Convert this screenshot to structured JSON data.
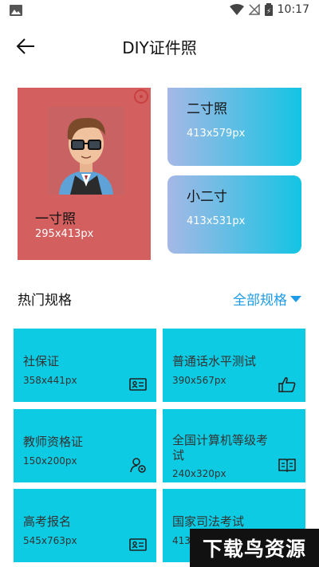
{
  "status": {
    "time": "10:17"
  },
  "header": {
    "title": "DIY证件照",
    "back_icon": "arrow-left-icon"
  },
  "featured": {
    "main": {
      "title": "一寸照",
      "size": "295x413px"
    },
    "side": [
      {
        "title": "二寸照",
        "size": "413x579px"
      },
      {
        "title": "小二寸",
        "size": "413x531px"
      }
    ]
  },
  "hot": {
    "title": "热门规格",
    "all_label": "全部规格"
  },
  "specs": [
    {
      "title": "社保证",
      "size": "358x441px",
      "icon": "id-card-icon"
    },
    {
      "title": "普通话水平测试",
      "size": "390x567px",
      "icon": "thumbs-up-icon"
    },
    {
      "title": "教师资格证",
      "size": "150x200px",
      "icon": "user-badge-icon"
    },
    {
      "title": "全国计算机等级考试",
      "size": "240x320px",
      "icon": "book-icon"
    },
    {
      "title": "高考报名",
      "size": "545x763px",
      "icon": "id-card-icon"
    },
    {
      "title": "国家司法考试",
      "size": "413x",
      "icon": "id-card-icon"
    }
  ],
  "watermark": {
    "text": "下载鸟资源"
  },
  "colors": {
    "accent": "#1e9be6",
    "card_cyan": "#0dcbe3",
    "card_red": "#d35f5f"
  }
}
